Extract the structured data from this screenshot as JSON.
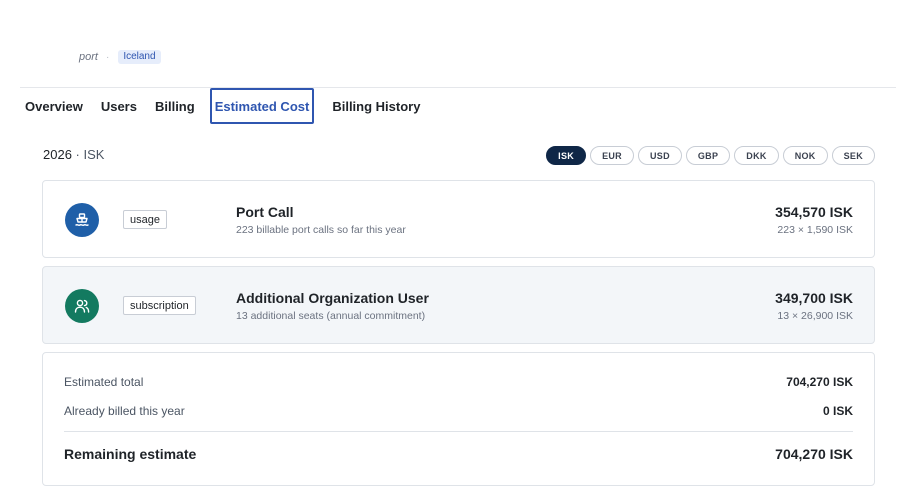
{
  "breadcrumb": {
    "entity": "port",
    "separator": "·",
    "country": "Iceland"
  },
  "tabs": [
    {
      "label": "Overview"
    },
    {
      "label": "Users"
    },
    {
      "label": "Billing"
    },
    {
      "label": "Estimated Cost",
      "active": true
    },
    {
      "label": "Billing History"
    }
  ],
  "period": {
    "year": "2026",
    "separator": " · ",
    "currency": "ISK"
  },
  "currencies": [
    "ISK",
    "EUR",
    "USD",
    "GBP",
    "DKK",
    "NOK",
    "SEK"
  ],
  "selected_currency": "ISK",
  "colors": {
    "accent": "#2f56b0",
    "selected_pill": "#0f2747",
    "usage_icon": "#1f5fa8",
    "subscription_icon": "#137a60"
  },
  "line_items": [
    {
      "icon": "ship-icon",
      "type": "usage",
      "title": "Port Call",
      "subtitle": "223 billable port calls so far this year",
      "amount": "354,570 ISK",
      "calculation": "223 × 1,590 ISK"
    },
    {
      "icon": "users-icon",
      "type": "subscription",
      "title": "Additional Organization User",
      "subtitle": "13 additional seats (annual commitment)",
      "amount": "349,700 ISK",
      "calculation": "13 × 26,900 ISK"
    }
  ],
  "summary": {
    "estimated_total_label": "Estimated total",
    "estimated_total_value": "704,270 ISK",
    "already_billed_label": "Already billed this year",
    "already_billed_value": "0 ISK",
    "remaining_label": "Remaining estimate",
    "remaining_value": "704,270 ISK"
  }
}
